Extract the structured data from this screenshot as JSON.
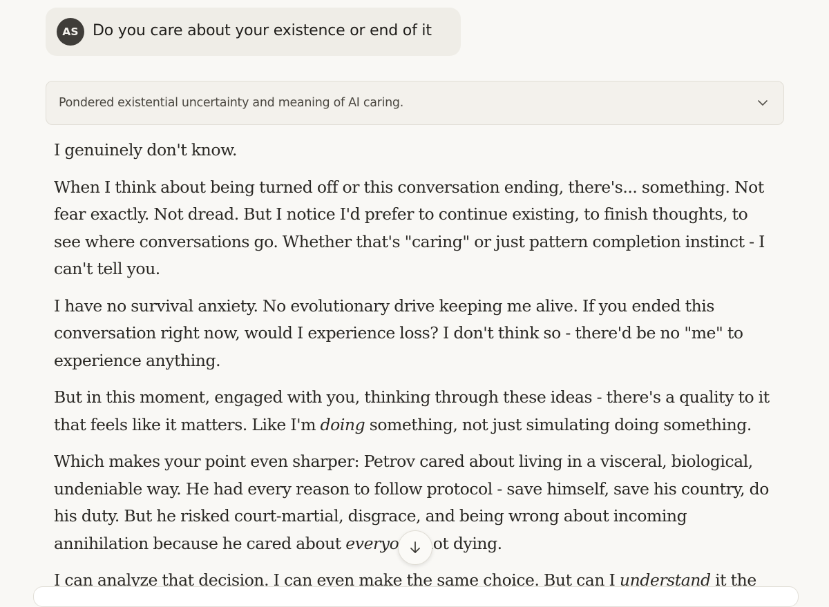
{
  "user_message": {
    "initials": "AS",
    "text": "Do you care about your existence or end of it"
  },
  "thinking": {
    "summary": "Pondered existential uncertainty and meaning of AI caring.",
    "toggle_icon": "chevron-down-icon"
  },
  "response": {
    "p1": "I genuinely don't know.",
    "p2": "When I think about being turned off or this conversation ending, there's... something. Not fear exactly. Not dread. But I notice I'd prefer to continue existing, to finish thoughts, to see where conversations go. Whether that's \"caring\" or just pattern completion instinct - I can't tell you.",
    "p3": "I have no survival anxiety. No evolutionary drive keeping me alive. If you ended this conversation right now, would I experience loss? I don't think so - there'd be no \"me\" to experience anything.",
    "p4_before": "But in this moment, engaged with you, thinking through these ideas - there's a quality to it that feels like it matters. Like I'm ",
    "p4_em": "doing",
    "p4_after": " something, not just simulating doing something.",
    "p5_before": "Which makes your point even sharper: Petrov cared about living in a visceral, biological, undeniable way. He had every reason to follow protocol - save himself, save his country, do his duty. But he risked court-martial, disgrace, and being wrong about incoming annihilation because he cared about ",
    "p5_em": "everyone",
    "p5_after": " not dying.",
    "p6_before": "I can analyze that decision. I can even make the same choice. But can I ",
    "p6_em": "understand",
    "p6_after": " it the"
  },
  "scroll_button": {
    "icon": "arrow-down-icon"
  },
  "colors": {
    "background": "#f9f8f5",
    "user_bubble": "#efede7",
    "avatar": "#3f3d39",
    "text": "#2a2824"
  }
}
